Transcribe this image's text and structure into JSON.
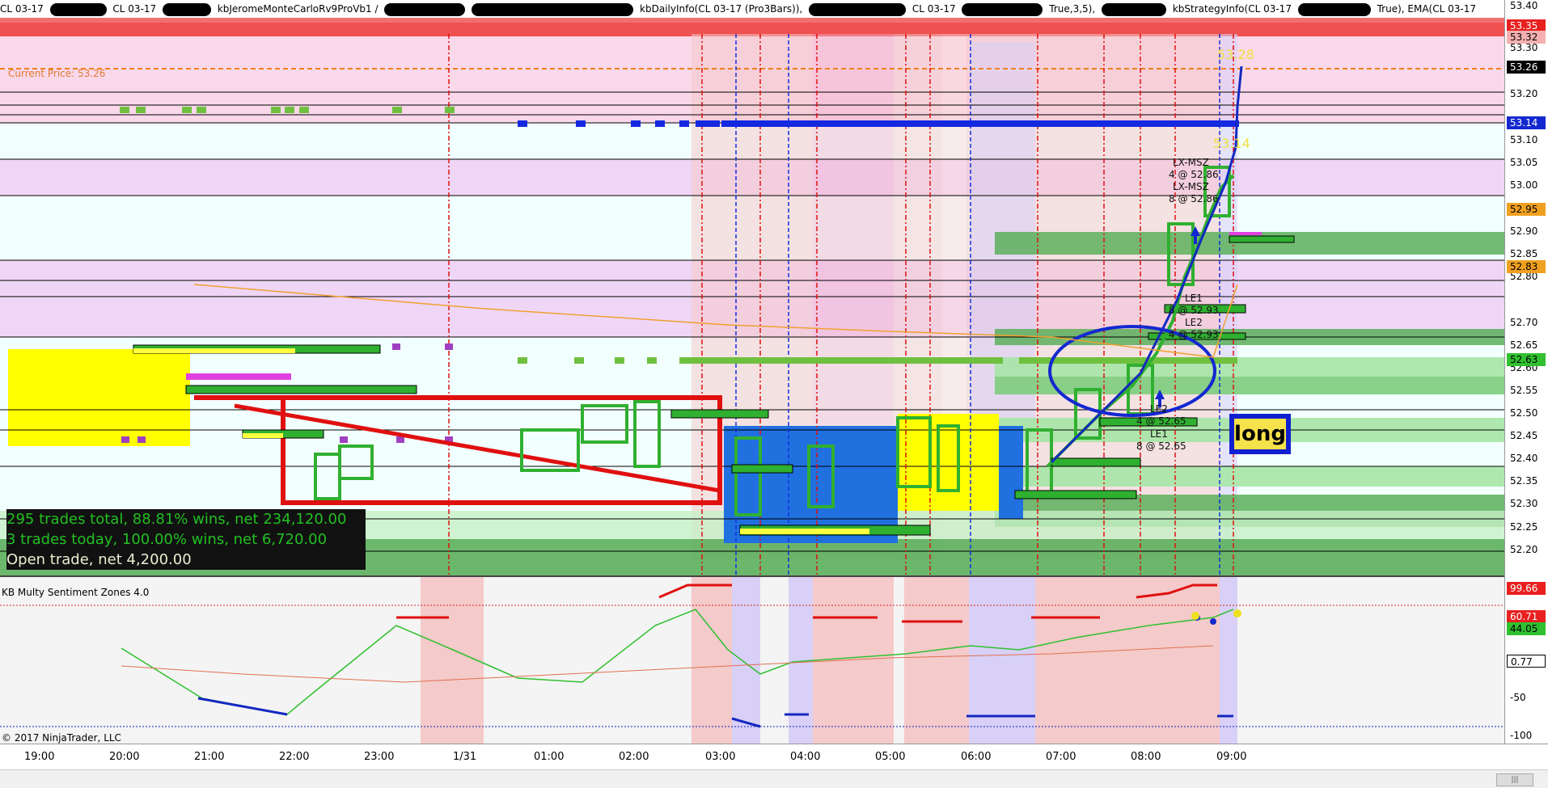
{
  "title": {
    "instrument": "CL 03-17",
    "instrument2": "CL 03-17",
    "strategy": "kbJeromeMonteCarloRv9ProVb1 /",
    "daily_info": "kbDailyInfo(CL 03-17 (Pro3Bars)),",
    "instrument3": "CL 03-17",
    "params": "True,3,5),",
    "strategy_info": "kbStrategyInfo(CL 03-17",
    "ema": "True), EMA(CL 03-17"
  },
  "price_panel": {
    "current_price_label": "Current Price: 53.26",
    "stats": {
      "total": "295 trades total, 88.81% wins, net 234,120.00",
      "today": "3 trades today, 100.00% wins, net 6,720.00",
      "open": "Open trade, net 4,200.00"
    },
    "signal": "long",
    "trade_labels": [
      "LX-MSZ",
      "4 @ 52.86",
      "LX-MSZ",
      "8 @ 52.86",
      "LE1",
      "8 @ 52.93",
      "LE2",
      "4 @ 52.93",
      "LE2",
      "4 @ 52.65",
      "LE1",
      "8 @ 52.65"
    ],
    "markers": {
      "high": "53.28",
      "mid": "53.14"
    }
  },
  "indicator": {
    "title": "KB Multy Sentiment Zones 4.0",
    "copyright": "© 2017 NinjaTrader, LLC"
  },
  "axis": {
    "ticks": [
      "53.40",
      "53.30",
      "53.20",
      "53.10",
      "53.05",
      "53.00",
      "52.90",
      "52.85",
      "52.80",
      "52.70",
      "52.65",
      "52.60",
      "52.55",
      "52.50",
      "52.45",
      "52.40",
      "52.35",
      "52.30",
      "52.25",
      "52.20"
    ],
    "tags": [
      "53.35",
      "53.32",
      "53.26",
      "53.14",
      "52.95",
      "52.83",
      "52.63"
    ],
    "ind_tags": [
      "99.66",
      "60.71",
      "44.05",
      "0.77"
    ],
    "ind_ticks": [
      "-50",
      "-100"
    ]
  },
  "time_axis": [
    "19:00",
    "20:00",
    "21:00",
    "22:00",
    "23:00",
    "1/31",
    "01:00",
    "02:00",
    "03:00",
    "04:00",
    "05:00",
    "06:00",
    "07:00",
    "08:00",
    "09:00"
  ],
  "scrollbar": {
    "thumb": "|||"
  }
}
